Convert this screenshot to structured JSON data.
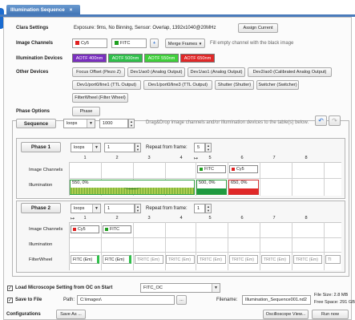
{
  "tab": {
    "title": "Illumination Sequence",
    "close": "×"
  },
  "clara": {
    "label": "Clara Settings",
    "info": "Exposure: 9ms, No Binning, Sensor: Overlap, 1392x1040@20MHz",
    "assign_button": "Assign Current"
  },
  "channels": {
    "label": "Image Channels",
    "items": [
      {
        "name": "Cy5",
        "color": "#e02020"
      },
      {
        "name": "FITC",
        "color": "#20a020"
      }
    ],
    "add": "+",
    "merge_button": "Merge Frames",
    "merge_arrow": "▼",
    "hint": "Fill empty channel with the black image"
  },
  "illum_devices": {
    "label": "Illumination Devices",
    "items": [
      {
        "name": "AOTF 400nm",
        "color": "#7a2fbf"
      },
      {
        "name": "AOTF 500nm",
        "color": "#2fbf4a"
      },
      {
        "name": "AOTF 550nm",
        "color": "#3fcf3a"
      },
      {
        "name": "AOTF 650nm",
        "color": "#e02828"
      }
    ]
  },
  "other_devices": {
    "label": "Other Devices",
    "items": [
      "Focus Offset (Piezo Z)",
      "Dev1/ao0 (Analog Output)",
      "Dev1/ao1 (Analog Output)",
      "Dev2/ao0 (Calibrated Analog Output)",
      "Dev1/port0/line1 (TTL Output)",
      "Dev1/port0/line3 (TTL Output)",
      "Shutter (Shutter)",
      "Switcher (Switcher)",
      "FilterWheel (Filter Wheel)"
    ]
  },
  "phase_options": {
    "label": "Phase Options",
    "phase_button": "Phase"
  },
  "sequence": {
    "label": "Sequence",
    "mode": "loops",
    "count": "1000",
    "hint": "Drag&Drop image channels and/or illumination devices to the table(s) below.",
    "undo_icon": "↶",
    "redo_icon": "↷"
  },
  "phase1": {
    "label": "Phase 1",
    "mode": "loops",
    "count": "1",
    "repeat_label": "Repeat from frame:",
    "repeat_value": "5",
    "columns": [
      "1",
      "2",
      "3",
      "4",
      "5",
      "6",
      "7",
      "8"
    ],
    "marker": "↦",
    "row_channels": "Image Channels",
    "row_illum": "Illumination",
    "cells": {
      "ch5": "FITC",
      "ch6": "Cy5",
      "il1": "550, 0%",
      "il5": "500, 0%",
      "il6": "650, 0%"
    }
  },
  "phase2": {
    "label": "Phase 2",
    "mode": "loops",
    "count": "1",
    "repeat_label": "Repeat from frame:",
    "repeat_value": "1",
    "columns": [
      "1",
      "2",
      "3",
      "4",
      "5",
      "6",
      "7",
      "8"
    ],
    "marker": "↦",
    "row_channels": "Image Channels",
    "row_illum": "Illumination",
    "row_fw": "FilterWheel",
    "cells": {
      "ch1": "Cy5",
      "ch2": "FITC"
    },
    "fw": [
      "FITC (Em)",
      "FITC (Em)",
      "TRITC (Em)",
      "TRITC (Em)",
      "TRITC (Em)",
      "TRITC (Em)",
      "TRITC (Em)",
      "TRITC (Em)",
      "TI"
    ]
  },
  "footer": {
    "load_label": "Load Microscope Setting from OC on Start",
    "load_value": "FITC_OC",
    "save_label": "Save to File",
    "path_label": "Path:",
    "path_value": "C:\\images\\",
    "browse": "...",
    "filename_label": "Filename:",
    "filename_value": "Illumination_Sequence001.nd2",
    "file_size": "File Size: 2.8 MB",
    "free_space": "Free Space: 291 GB",
    "config_label": "Configurations",
    "save_as": "Save As ...",
    "oscilloscope": "Oscilloscope View...",
    "run_now": "Run now"
  }
}
